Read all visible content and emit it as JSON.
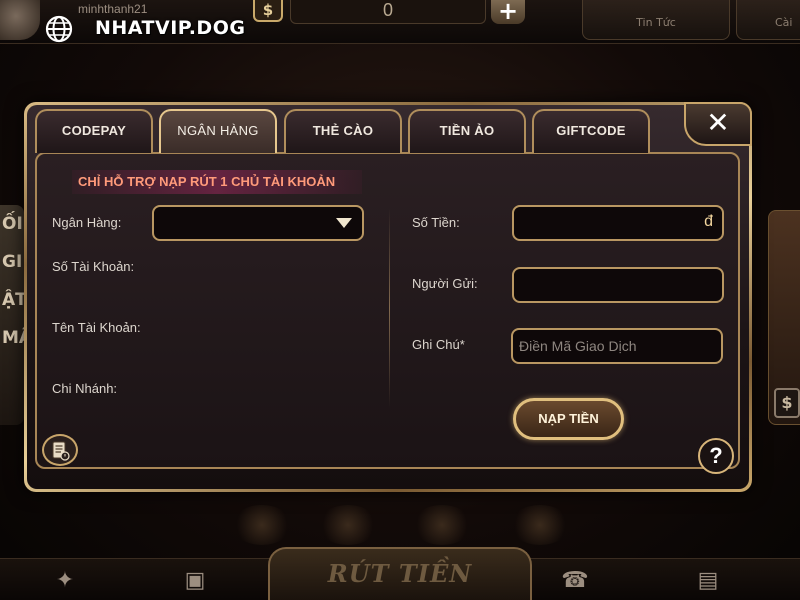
{
  "watermark": {
    "text": "NHATVIP.DOG",
    "icon": "globe-icon"
  },
  "topbar": {
    "username": "minhthanh21",
    "currency_symbol": "$",
    "balance": "0",
    "add_label": "+",
    "news_label": "Tin Tức",
    "settings_label": "Cài"
  },
  "background": {
    "left_card_text": "ỐI\nGI\nẬT\nMÃ",
    "right_coin_symbol": "$",
    "bottom_main_label": "RÚT TIỀN"
  },
  "dialog": {
    "close_label": "✕",
    "tabs": [
      {
        "label": "CODEPAY",
        "active": false
      },
      {
        "label": "NGÂN HÀNG",
        "active": true
      },
      {
        "label": "THẺ CÀO",
        "active": false
      },
      {
        "label": "TIỀN ẢO",
        "active": false
      },
      {
        "label": "GIFTCODE",
        "active": false
      }
    ],
    "notice": "CHỈ HỖ TRỢ NẠP RÚT 1 CHỦ TÀI KHOẢN",
    "left": {
      "bank_label": "Ngân Hàng:",
      "bank_value": "",
      "account_number_label": "Số Tài Khoản:",
      "account_name_label": "Tên Tài Khoản:",
      "branch_label": "Chi Nhánh:"
    },
    "right": {
      "amount_label": "Số Tiền:",
      "amount_value": "",
      "currency": "đ",
      "sender_label": "Người Gửi:",
      "sender_value": "",
      "note_label": "Ghi Chú*",
      "note_placeholder": "Điền Mã Giao Dịch"
    },
    "deposit_button": "NẠP TIỀN",
    "help_label": "?"
  },
  "colors": {
    "accent_gold": "#c9a76b",
    "notice_text": "#ff9a7a",
    "panel_bg": "#1c1416"
  }
}
